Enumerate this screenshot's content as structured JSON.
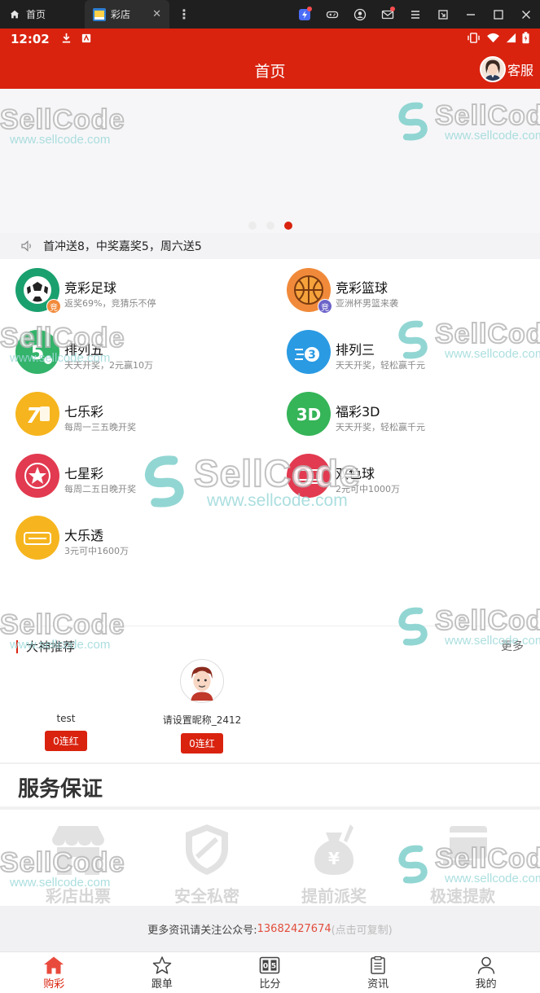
{
  "browser": {
    "home_tab": "首页",
    "active_tab": "彩店"
  },
  "status": {
    "time": "12:02"
  },
  "header": {
    "title": "首页",
    "service": "客服"
  },
  "notice": {
    "text": "首冲送8，中奖嘉奖5，周六送5"
  },
  "lotteries": [
    {
      "name": "竞彩足球",
      "desc": "返奖69%，竞猜乐不停",
      "color": "#1aa06e",
      "badge": "竞",
      "badge_color": "#f28a3a",
      "icon": "soccer-ball-icon"
    },
    {
      "name": "竞彩篮球",
      "desc": "亚洲杯男篮来袭",
      "color": "#f08a3a",
      "badge": "竞",
      "badge_color": "#6c63c9",
      "icon": "basketball-icon"
    },
    {
      "name": "排列五",
      "desc": "天天开奖，2元赢10万",
      "color": "#34b36a",
      "icon": "pl5-icon"
    },
    {
      "name": "排列三",
      "desc": "天天开奖，轻松赢千元",
      "color": "#2a9ae3",
      "icon": "pl3-icon"
    },
    {
      "name": "七乐彩",
      "desc": "每周一三五晚开奖",
      "color": "#f6b51e",
      "icon": "qlc-icon"
    },
    {
      "name": "福彩3D",
      "desc": "天天开奖，轻松赢千元",
      "color": "#35b458",
      "icon": "fc3d-icon"
    },
    {
      "name": "七星彩",
      "desc": "每周二五日晚开奖",
      "color": "#e23a50",
      "icon": "qxc-icon"
    },
    {
      "name": "双色球",
      "desc": "2元可中1000万",
      "color": "#e23a50",
      "icon": "ssq-icon"
    },
    {
      "name": "大乐透",
      "desc": "3元可中1600万",
      "color": "#f6b51e",
      "icon": "dlt-icon"
    }
  ],
  "experts": {
    "title": "大神推荐",
    "more": "更多",
    "items": [
      {
        "name": "test",
        "badge": "0连红"
      },
      {
        "name": "请设置昵称_2412",
        "badge": "0连红"
      }
    ]
  },
  "service": {
    "title": "服务保证",
    "items": [
      {
        "label": "彩店出票",
        "icon": "shop-icon"
      },
      {
        "label": "安全私密",
        "icon": "shield-icon"
      },
      {
        "label": "提前派奖",
        "icon": "money-bag-icon"
      },
      {
        "label": "极速提款",
        "icon": "card-icon"
      }
    ]
  },
  "footer": {
    "prefix": "更多资讯请关注公众号:",
    "phone": "13682427674",
    "hint": "(点击可复制)"
  },
  "nav": [
    {
      "label": "购彩",
      "icon": "home-icon",
      "active": true
    },
    {
      "label": "跟单",
      "icon": "star-icon",
      "active": false
    },
    {
      "label": "比分",
      "icon": "score-icon",
      "active": false
    },
    {
      "label": "资讯",
      "icon": "clipboard-icon",
      "active": false
    },
    {
      "label": "我的",
      "icon": "person-icon",
      "active": false
    }
  ],
  "watermark": {
    "brand": "SellCode",
    "url": "www.sellcode.com"
  }
}
